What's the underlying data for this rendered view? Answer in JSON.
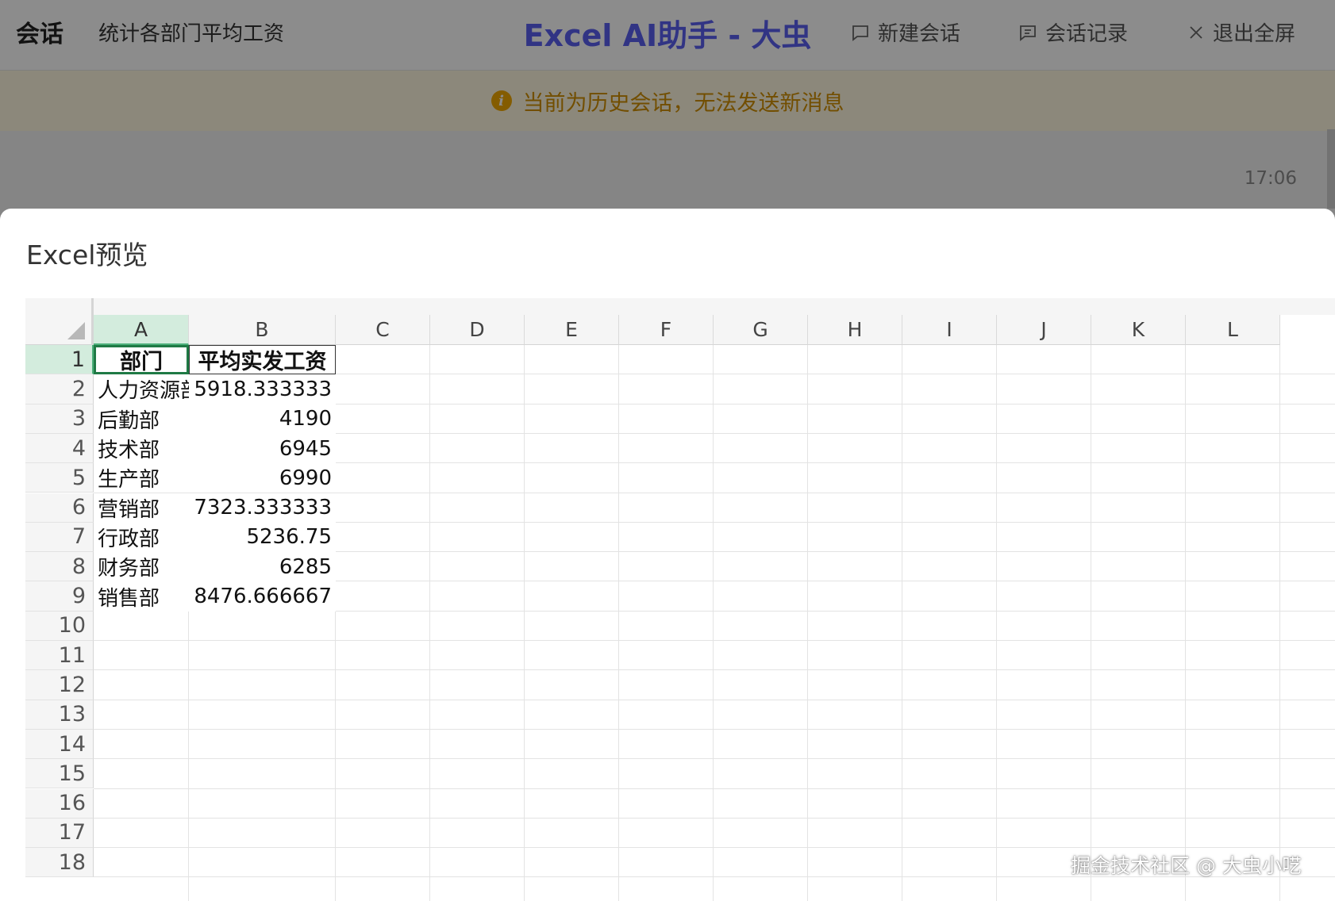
{
  "header": {
    "left_title": "会话",
    "conversation_name": "统计各部门平均工资",
    "app_title": "Excel AI助手 - 大虫",
    "actions": {
      "new_chat": "新建会话",
      "history": "会话记录",
      "exit_fullscreen": "退出全屏"
    }
  },
  "notice": {
    "icon": "info-icon",
    "text": "当前为历史会话，无法发送新消息"
  },
  "chat": {
    "timestamp": "17:06"
  },
  "modal": {
    "title": "Excel预览"
  },
  "spreadsheet": {
    "columns": [
      "A",
      "B",
      "C",
      "D",
      "E",
      "F",
      "G",
      "H",
      "I",
      "J",
      "K",
      "L"
    ],
    "row_numbers": [
      "1",
      "2",
      "3",
      "4",
      "5",
      "6",
      "7",
      "8",
      "9",
      "10",
      "11",
      "12",
      "13",
      "14",
      "15",
      "16",
      "17",
      "18"
    ],
    "selected_cell": "A1",
    "header_row": [
      "部门",
      "平均实发工资"
    ],
    "rows": [
      {
        "department": "人力资源部",
        "avg_salary": "5918.333333"
      },
      {
        "department": "后勤部",
        "avg_salary": "4190"
      },
      {
        "department": "技术部",
        "avg_salary": "6945"
      },
      {
        "department": "生产部",
        "avg_salary": "6990"
      },
      {
        "department": "营销部",
        "avg_salary": "7323.333333"
      },
      {
        "department": "行政部",
        "avg_salary": "5236.75"
      },
      {
        "department": "财务部",
        "avg_salary": "6285"
      },
      {
        "department": "销售部",
        "avg_salary": "8476.666667"
      }
    ]
  },
  "watermark": "掘金技术社区 @ 大虫小呓",
  "colors": {
    "accent": "#5a5ff0",
    "notice_text": "#d08e00",
    "selection_green": "#1f7a45"
  }
}
